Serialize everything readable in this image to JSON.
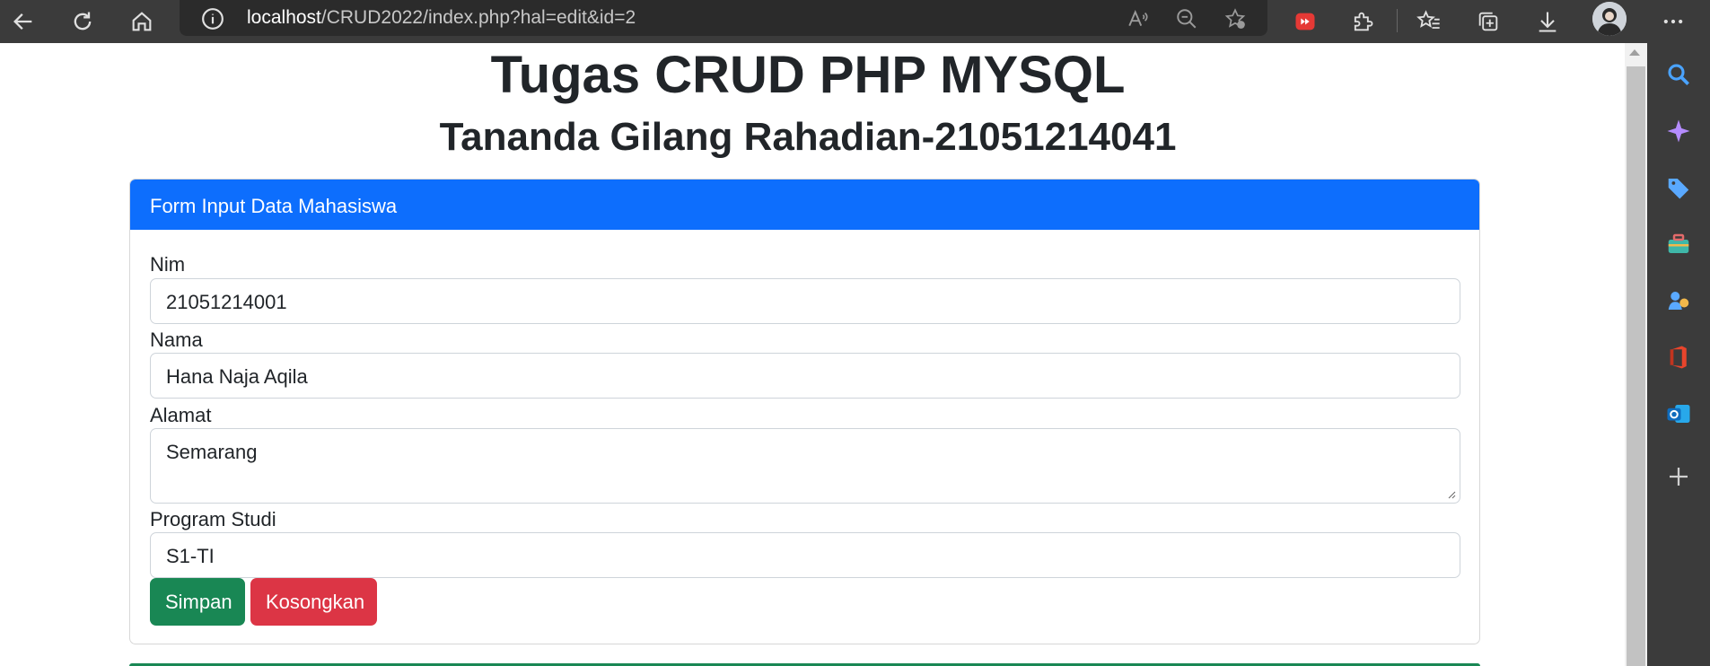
{
  "browser": {
    "url_host": "localhost",
    "url_path": "/CRUD2022/index.php?hal=edit&id=2"
  },
  "page": {
    "title": "Tugas CRUD PHP MYSQL",
    "subtitle": "Tananda Gilang Rahadian-21051214041"
  },
  "form": {
    "header": "Form Input Data Mahasiswa",
    "nim_label": "Nim",
    "nim_value": "21051214001",
    "nama_label": "Nama",
    "nama_value": "Hana Naja Aqila",
    "alamat_label": "Alamat",
    "alamat_value": "Semarang",
    "prodi_label": "Program Studi",
    "prodi_value": "S1-TI",
    "save_label": "Simpan",
    "clear_label": "Kosongkan"
  },
  "colors": {
    "primary": "#0d6efd",
    "success": "#198754",
    "danger": "#dc3545",
    "browser_chrome": "#3b3b3b"
  }
}
